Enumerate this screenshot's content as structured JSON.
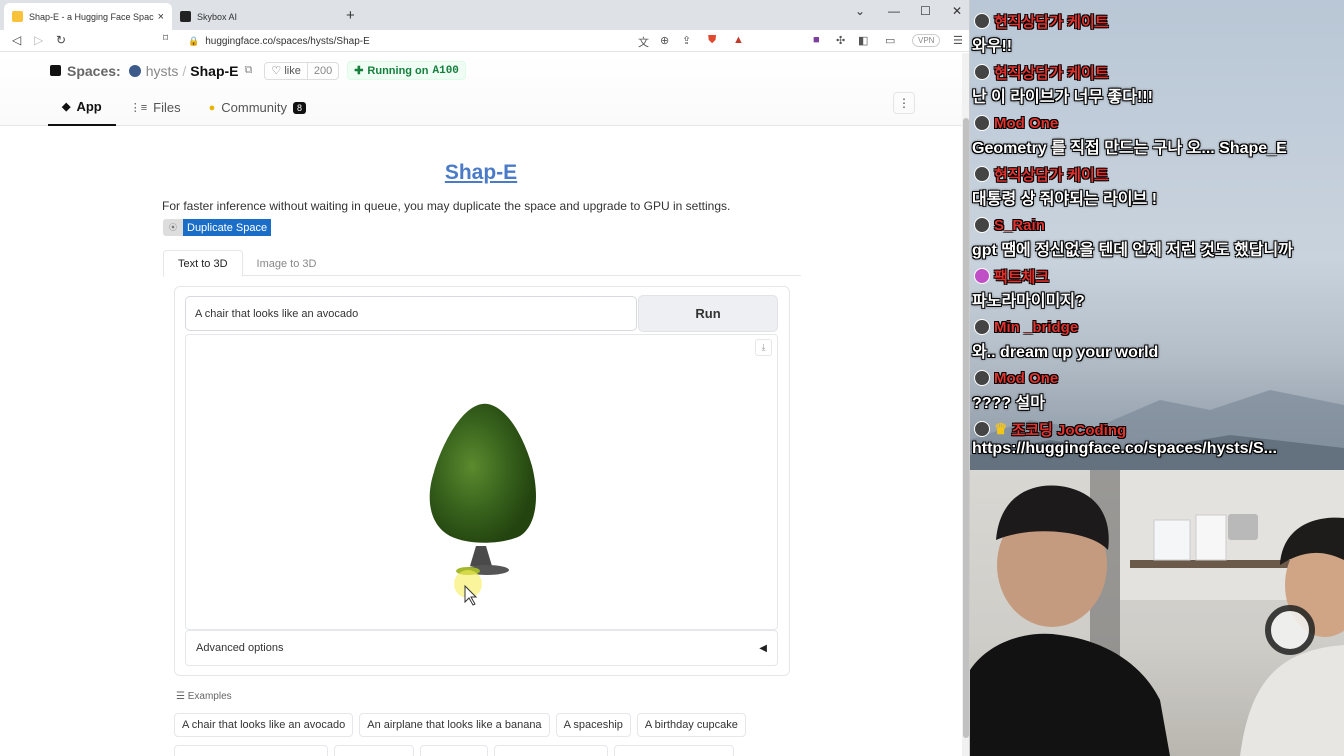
{
  "browser": {
    "tabs": [
      {
        "title": "Shap-E - a Hugging Face Space",
        "close": "×"
      },
      {
        "title": "Skybox AI"
      }
    ],
    "new_tab": "+",
    "window_controls": {
      "dropdown": "⌄",
      "minimize": "—",
      "maximize": "☐",
      "close": "✕"
    },
    "nav": {
      "back": "◁",
      "forward": "▷",
      "reload": "↻",
      "bookmark": "🔖"
    },
    "url": "huggingface.co/spaces/hysts/Shap-E",
    "vpn": "VPN"
  },
  "hf": {
    "spaces_label": "Spaces:",
    "owner": "hysts",
    "slash": "/",
    "repo": "Shap-E",
    "like_label": "like",
    "like_count": "200",
    "status_prefix": "Running on",
    "hardware": "A100",
    "tabs": [
      {
        "label": "App"
      },
      {
        "label": "Files"
      },
      {
        "label": "Community",
        "badge": "8"
      }
    ]
  },
  "app": {
    "title": "Shap-E",
    "description": "For faster inference without waiting in queue, you may duplicate the space and upgrade to GPU in settings.",
    "duplicate_label": "Duplicate Space",
    "mode_tabs": [
      "Text to 3D",
      "Image to 3D"
    ],
    "prompt_value": "A chair that looks like an avocado",
    "run_label": "Run",
    "advanced_label": "Advanced options",
    "examples_label": "Examples",
    "examples": [
      "A chair that looks like an avocado",
      "An airplane that looks like a banana",
      "A spaceship",
      "A birthday cupcake"
    ]
  },
  "chat": [
    {
      "user": "현직상담가 케이트",
      "text": "와우!!"
    },
    {
      "user": "현직상담가 케이트",
      "text": "난 이 라이브가 너무 좋다!!!"
    },
    {
      "user": "Mod One",
      "text": "Geometry 를 직접 만드는 구나 오... Shape_E"
    },
    {
      "user": "현직상담가 케이트",
      "text": "대통령 상 줘야되는 라이브 !"
    },
    {
      "user": "S_Rain",
      "text": "gpt 땜에 정신없을 텐데 언제 저런 것도 했답니까"
    },
    {
      "user": "팩트체크",
      "text": "파노라마이미지?"
    },
    {
      "user": "Min _bridge",
      "text": "와.. dream up your world"
    },
    {
      "user": "Mod One",
      "text": "???? 설마"
    },
    {
      "user": "조코딩 JoCoding",
      "text": "https://huggingface.co/spaces/hysts/S..."
    }
  ],
  "colors": {
    "accent_link": "#4b7bc8",
    "duplicate_btn": "#1a6ec7",
    "running_green": "#15803d",
    "chat_name": "#e2322e"
  }
}
